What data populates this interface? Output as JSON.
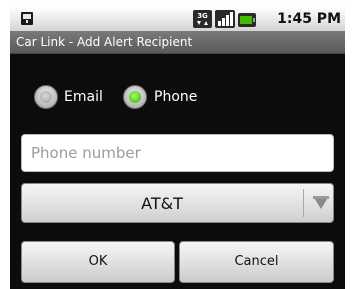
{
  "status_bar": {
    "time": "1:45 PM",
    "network_type": "3G",
    "icons": [
      "notification-icon",
      "3g-icon",
      "signal-icon",
      "battery-icon"
    ]
  },
  "title_bar": {
    "title": "Car Link - Add Alert Recipient"
  },
  "alert_type": {
    "options": [
      {
        "label": "Email",
        "checked": false
      },
      {
        "label": "Phone",
        "checked": true
      }
    ]
  },
  "phone_field": {
    "value": "",
    "placeholder": "Phone number"
  },
  "carrier_select": {
    "selected": "AT&T",
    "icon": "chevron-down-icon"
  },
  "buttons": {
    "ok": "OK",
    "cancel": "Cancel"
  },
  "colors": {
    "background": "#0c0c0c",
    "title_bar": "#6a6a6a",
    "radio_checked": "#3cc000",
    "status_bar": "#e6e6e6"
  }
}
